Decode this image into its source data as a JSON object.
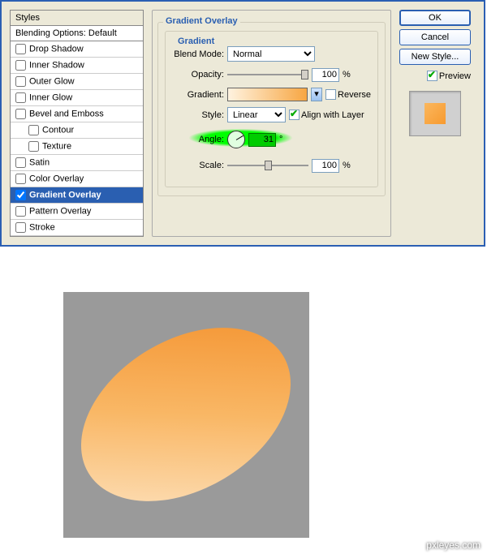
{
  "styles_panel": {
    "header": "Styles",
    "default": "Blending Options: Default",
    "items": [
      {
        "label": "Drop Shadow",
        "checked": false,
        "indent": false
      },
      {
        "label": "Inner Shadow",
        "checked": false,
        "indent": false
      },
      {
        "label": "Outer Glow",
        "checked": false,
        "indent": false
      },
      {
        "label": "Inner Glow",
        "checked": false,
        "indent": false
      },
      {
        "label": "Bevel and Emboss",
        "checked": false,
        "indent": false
      },
      {
        "label": "Contour",
        "checked": false,
        "indent": true
      },
      {
        "label": "Texture",
        "checked": false,
        "indent": true
      },
      {
        "label": "Satin",
        "checked": false,
        "indent": false
      },
      {
        "label": "Color Overlay",
        "checked": false,
        "indent": false
      },
      {
        "label": "Gradient Overlay",
        "checked": true,
        "indent": false,
        "selected": true
      },
      {
        "label": "Pattern Overlay",
        "checked": false,
        "indent": false
      },
      {
        "label": "Stroke",
        "checked": false,
        "indent": false
      }
    ]
  },
  "options": {
    "title": "Gradient Overlay",
    "group_title": "Gradient",
    "blend_mode_label": "Blend Mode:",
    "blend_mode_value": "Normal",
    "opacity_label": "Opacity:",
    "opacity_value": "100",
    "pct": "%",
    "gradient_label": "Gradient:",
    "reverse_label": "Reverse",
    "reverse_checked": false,
    "style_label": "Style:",
    "style_value": "Linear",
    "align_label": "Align with Layer",
    "align_checked": true,
    "angle_label": "Angle:",
    "angle_value": "31",
    "deg": "°",
    "scale_label": "Scale:",
    "scale_value": "100"
  },
  "buttons": {
    "ok": "OK",
    "cancel": "Cancel",
    "new_style": "New Style...",
    "preview": "Preview"
  },
  "watermark": "pxleyes.com"
}
